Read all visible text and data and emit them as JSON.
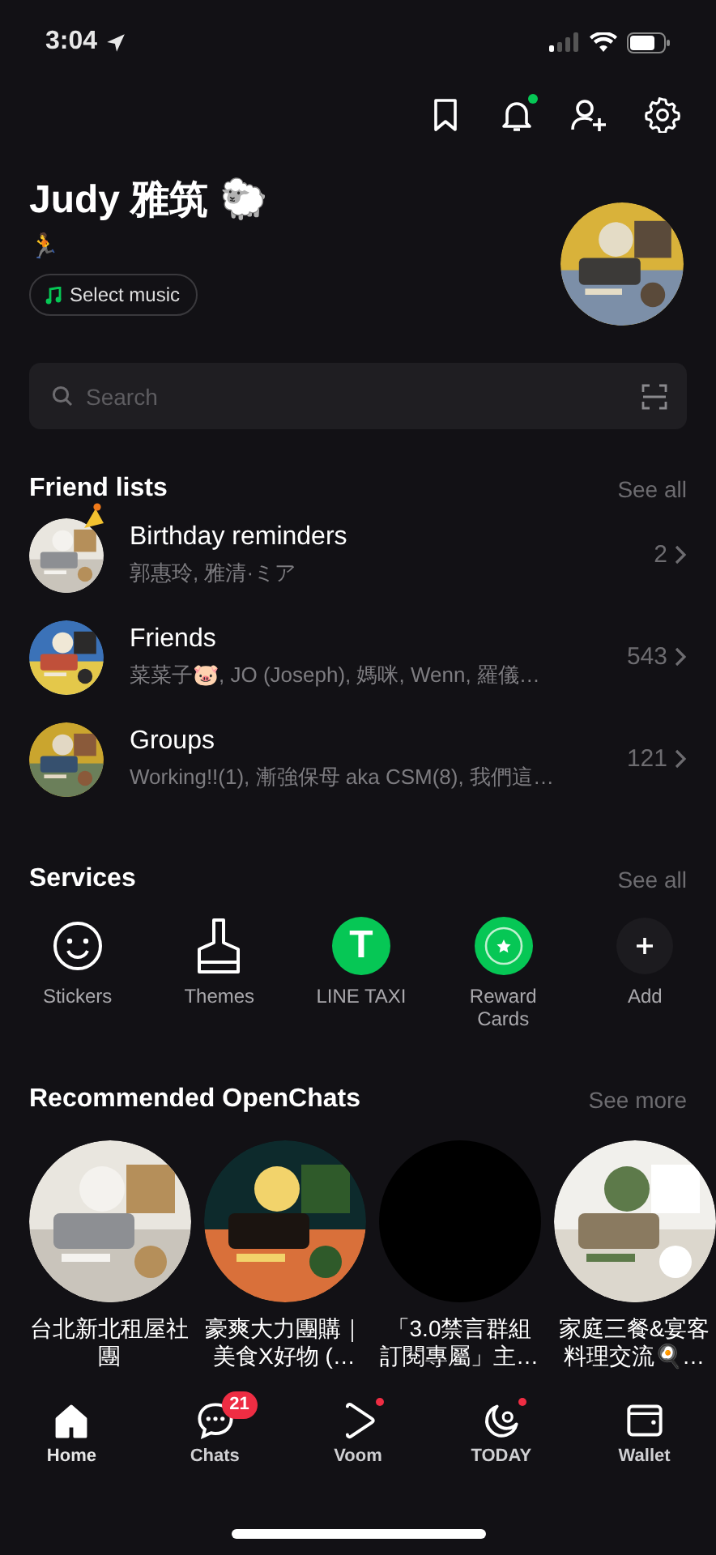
{
  "status_bar": {
    "time": "3:04"
  },
  "header": {
    "notification_dot": true
  },
  "profile": {
    "name": "Judy 雅筑 🐑",
    "status": "🏃",
    "music_button": "Select music"
  },
  "search": {
    "placeholder": "Search"
  },
  "friend_lists": {
    "title": "Friend lists",
    "see_all": "See all",
    "items": [
      {
        "title": "Birthday reminders",
        "subtitle": "郭惠玲, 雅清·ミア",
        "count": "2",
        "party_hat": true
      },
      {
        "title": "Friends",
        "subtitle": "菜菜子🐷, JO (Joseph), 媽咪, Wenn, 羅儀…",
        "count": "543",
        "party_hat": false
      },
      {
        "title": "Groups",
        "subtitle": "Working!!(1), 漸強保母 aka CSM(8), 我們這…",
        "count": "121",
        "party_hat": false
      }
    ]
  },
  "services": {
    "title": "Services",
    "see_all": "See all",
    "items": [
      {
        "label": "Stickers",
        "kind": "sticker"
      },
      {
        "label": "Themes",
        "kind": "theme"
      },
      {
        "label": "LINE TAXI",
        "kind": "taxi",
        "glyph": "T"
      },
      {
        "label": "Reward Cards",
        "kind": "reward"
      },
      {
        "label": "Add",
        "kind": "add"
      }
    ]
  },
  "openchats": {
    "title": "Recommended OpenChats",
    "see_more": "See more",
    "items": [
      {
        "title": "台北新北租屋社團",
        "kind": "picture"
      },
      {
        "title": "豪爽大力團購｜美食X好物 (…",
        "kind": "picture"
      },
      {
        "title": "「3.0禁言群組訂閱專屬」主…",
        "kind": "blank"
      },
      {
        "title": "家庭三餐&宴客料理交流🍳…",
        "kind": "picture"
      }
    ]
  },
  "tabs": [
    {
      "label": "Home",
      "selected": true
    },
    {
      "label": "Chats",
      "selected": false,
      "badge": "21"
    },
    {
      "label": "Voom",
      "selected": false,
      "dot": true
    },
    {
      "label": "TODAY",
      "selected": false,
      "dot": true
    },
    {
      "label": "Wallet",
      "selected": false
    }
  ]
}
